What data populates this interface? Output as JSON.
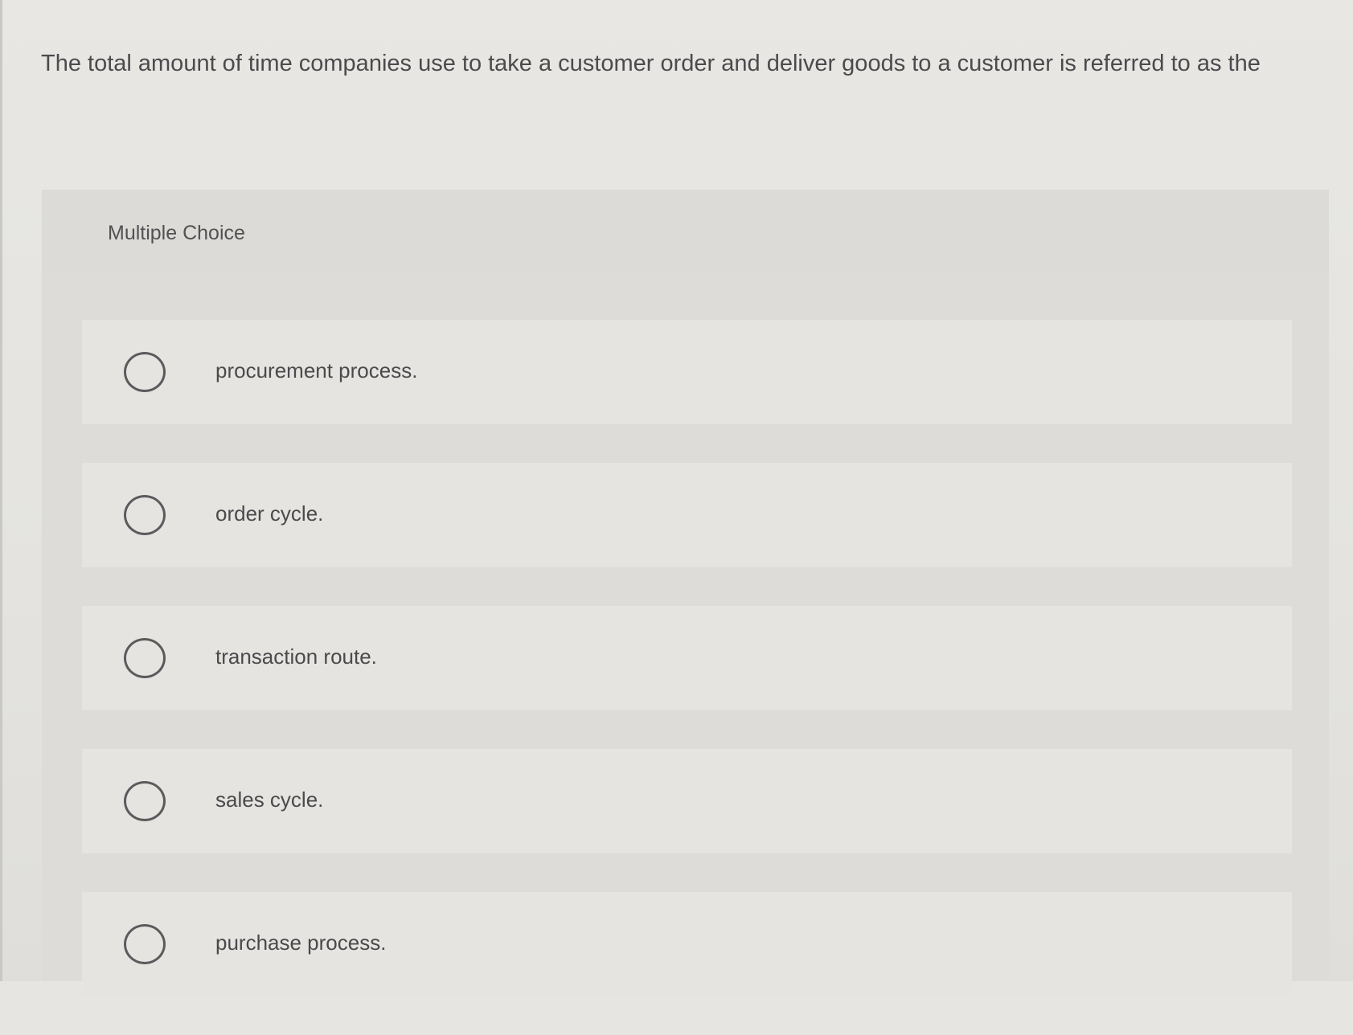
{
  "question": {
    "text": "The total amount of time companies use to take a customer order and deliver goods to a customer is referred to as the"
  },
  "multiple_choice": {
    "title": "Multiple Choice",
    "options": [
      {
        "label": "procurement process.",
        "selected": false
      },
      {
        "label": "order cycle.",
        "selected": false
      },
      {
        "label": "transaction route.",
        "selected": false
      },
      {
        "label": "sales cycle.",
        "selected": false
      },
      {
        "label": "purchase process.",
        "selected": false
      }
    ]
  }
}
